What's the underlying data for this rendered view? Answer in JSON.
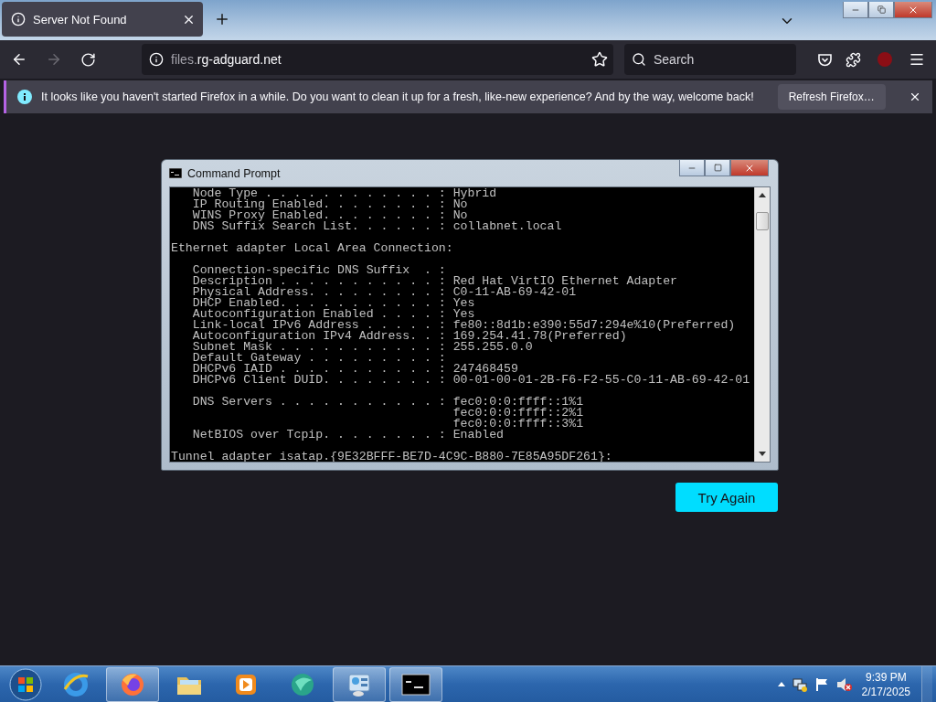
{
  "browser": {
    "tabs": [
      {
        "title": "Server Not Found",
        "selected": true
      }
    ],
    "nav": {
      "forward_disabled": true
    },
    "address": {
      "host_prefix": "files.",
      "host": "rg-adguard.net"
    },
    "search": {
      "placeholder": "Search"
    },
    "notification": {
      "message": "It looks like you haven't started Firefox in a while. Do you want to clean it up for a fresh, like-new experience? And by the way, welcome back!",
      "button": "Refresh Firefox…"
    },
    "page": {
      "button": "Try Again"
    }
  },
  "cmd": {
    "title": "Command Prompt",
    "blocks": [
      [
        "   Node Type . . . . . . . . . . . . : Hybrid",
        "   IP Routing Enabled. . . . . . . . : No",
        "   WINS Proxy Enabled. . . . . . . . : No",
        "   DNS Suffix Search List. . . . . . : collabnet.local"
      ],
      [
        "Ethernet adapter Local Area Connection:"
      ],
      [
        "   Connection-specific DNS Suffix  . :",
        "   Description . . . . . . . . . . . : Red Hat VirtIO Ethernet Adapter",
        "   Physical Address. . . . . . . . . : C0-11-AB-69-42-01",
        "   DHCP Enabled. . . . . . . . . . . : Yes",
        "   Autoconfiguration Enabled . . . . : Yes",
        "   Link-local IPv6 Address . . . . . : fe80::8d1b:e390:55d7:294e%10(Preferred)",
        "   Autoconfiguration IPv4 Address. . : 169.254.41.78(Preferred)",
        "   Subnet Mask . . . . . . . . . . . : 255.255.0.0",
        "   Default Gateway . . . . . . . . . :",
        "   DHCPv6 IAID . . . . . . . . . . . : 247468459",
        "   DHCPv6 Client DUID. . . . . . . . : 00-01-00-01-2B-F6-F2-55-C0-11-AB-69-42-01"
      ],
      [
        "   DNS Servers . . . . . . . . . . . : fec0:0:0:ffff::1%1",
        "                                       fec0:0:0:ffff::2%1",
        "                                       fec0:0:0:ffff::3%1",
        "   NetBIOS over Tcpip. . . . . . . . : Enabled"
      ],
      [
        "Tunnel adapter isatap.{9E32BFFF-BE7D-4C9C-B880-7E85A95DF261}:"
      ]
    ]
  },
  "taskbar": {
    "apps": [
      {
        "kind": "ie",
        "running": false
      },
      {
        "kind": "firefox",
        "running": true
      },
      {
        "kind": "explorer",
        "running": false
      },
      {
        "kind": "media",
        "running": false
      },
      {
        "kind": "orb",
        "running": false
      },
      {
        "kind": "control",
        "running": true
      },
      {
        "kind": "cmd",
        "running": true
      }
    ],
    "clock": {
      "time": "9:39 PM",
      "date": "2/17/2025"
    }
  }
}
